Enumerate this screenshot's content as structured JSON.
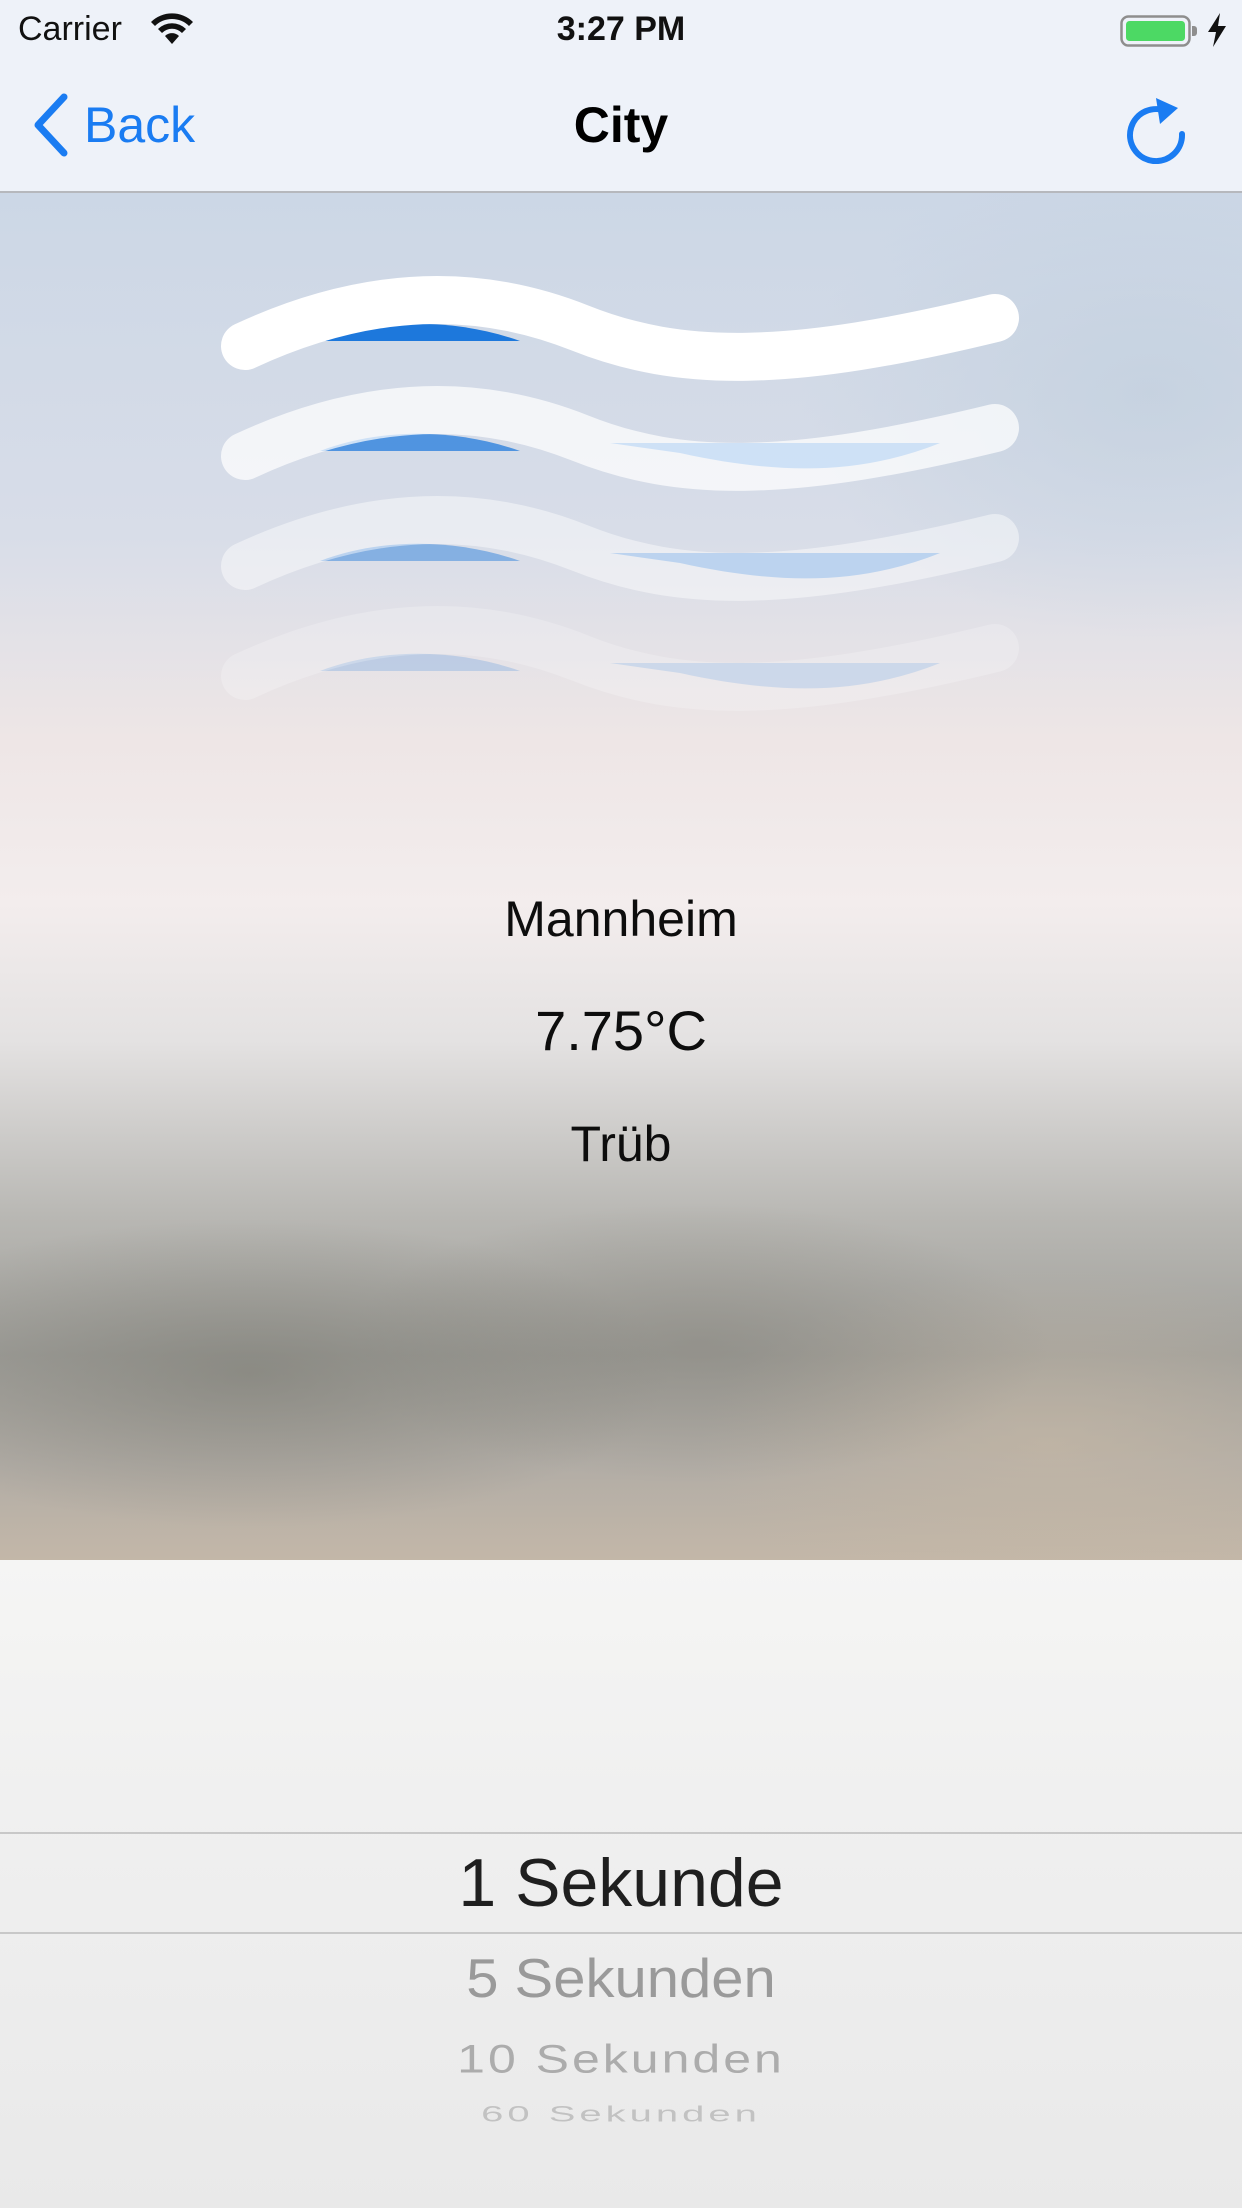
{
  "status_bar": {
    "carrier": "Carrier",
    "time": "3:27 PM",
    "icons": [
      "wifi-icon",
      "battery-icon",
      "charging-icon"
    ],
    "battery_color": "#4cd964"
  },
  "nav_bar": {
    "back_label": "Back",
    "title": "City",
    "icons": [
      "chevron-left-icon",
      "refresh-icon"
    ],
    "accent_color": "#1a7cf2"
  },
  "weather": {
    "icon": "fog-icon",
    "city": "Mannheim",
    "temperature": "7.75°C",
    "condition": "Trüb"
  },
  "picker": {
    "options": [
      "1 Sekunde",
      "5 Sekunden",
      "10 Sekunden",
      "60 Sekunden"
    ],
    "selected": "1 Sekunde"
  }
}
